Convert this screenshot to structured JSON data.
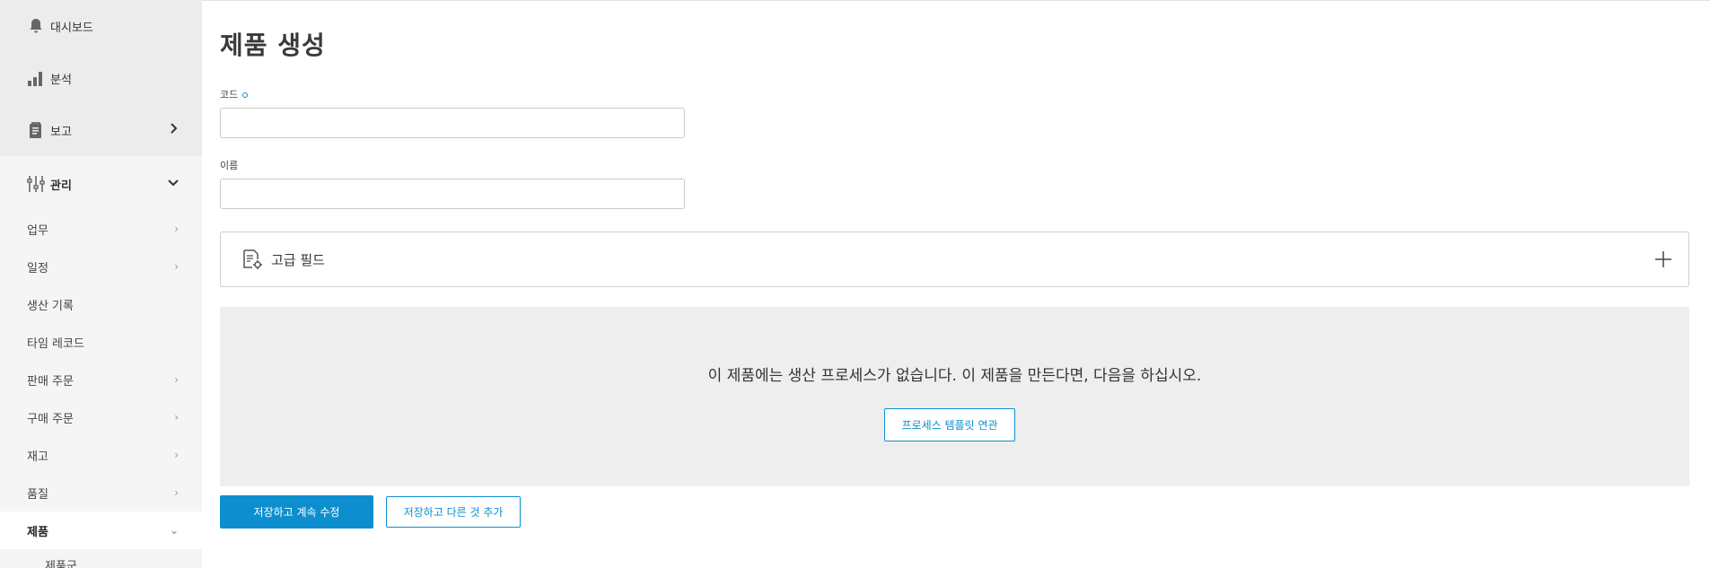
{
  "sidebar": {
    "top_items": [
      {
        "label": "대시보드",
        "icon": "bell-icon"
      },
      {
        "label": "분석",
        "icon": "bar-chart-icon"
      },
      {
        "label": "보고",
        "icon": "document-icon"
      }
    ],
    "admin": {
      "label": "관리",
      "icon": "sliders-icon"
    },
    "sub_items": [
      {
        "label": "업무"
      },
      {
        "label": "일정"
      },
      {
        "label": "생산 기록"
      },
      {
        "label": "타임 레코드"
      },
      {
        "label": "판매 주문"
      },
      {
        "label": "구매 주문"
      },
      {
        "label": "재고"
      },
      {
        "label": "품질"
      },
      {
        "label": "제품"
      }
    ],
    "sub_sub_items": [
      {
        "label": "제품군"
      }
    ]
  },
  "main": {
    "title": "제품 생성",
    "code_label": "코드",
    "name_label": "이름",
    "code_value": "",
    "name_value": "",
    "advanced_label": "고급 필드",
    "empty_message": "이 제품에는 생산 프로세스가 없습니다. 이 제품을 만든다면, 다음을 하십시오.",
    "template_button": "프로세스 템플릿 연관",
    "save_continue": "저장하고 계속 수정",
    "save_add": "저장하고 다른 것 추가"
  },
  "colors": {
    "accent": "#0d8fcf",
    "sidebar_bg": "#f5f5f5",
    "panel_bg": "#eeeeee"
  }
}
